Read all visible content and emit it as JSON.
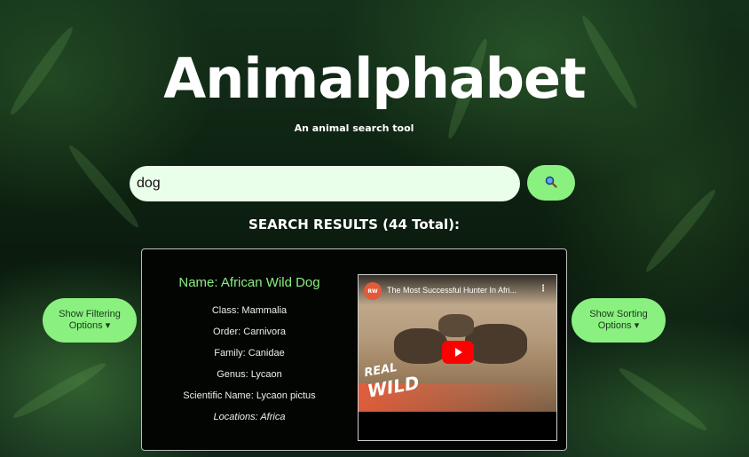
{
  "header": {
    "title": "Animalphabet",
    "subtitle": "An animal search tool"
  },
  "search": {
    "value": "dog",
    "placeholder": "",
    "button_icon": "magnifier-icon"
  },
  "results": {
    "heading": "SEARCH RESULTS (44 Total):"
  },
  "controls": {
    "filter_line1": "Show Filtering",
    "filter_line2": "Options ▾",
    "sort_line1": "Show Sorting",
    "sort_line2": "Options ▾"
  },
  "card": {
    "name": "Name: African Wild Dog",
    "class": "Class: Mammalia",
    "order": "Order: Carnivora",
    "family": "Family: Canidae",
    "genus": "Genus: Lycaon",
    "scientific_name": "Scientific Name: Lycaon pictus",
    "locations": "Locations: Africa"
  },
  "video": {
    "title": "The Most Successful Hunter In Afri...",
    "brand_line1": "REAL",
    "brand_line2": "WILD",
    "channel_avatar_text": "RW",
    "more_icon": "kebab-menu-icon",
    "play_icon": "play-icon"
  },
  "colors": {
    "accent": "#8af080",
    "input_bg": "#eaffea",
    "card_bg": "#030503",
    "youtube_red": "#ff0000"
  }
}
